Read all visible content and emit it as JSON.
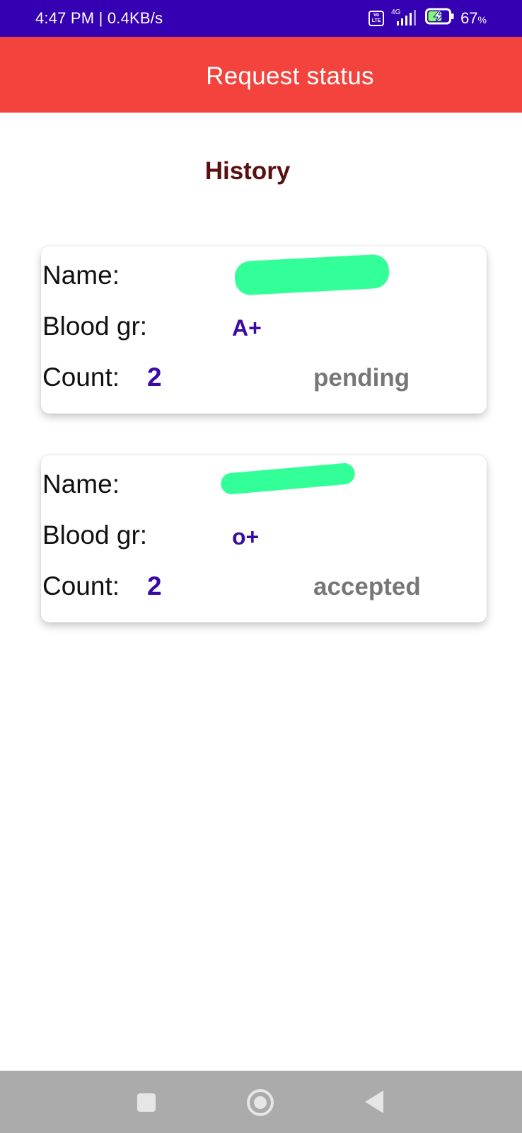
{
  "status_bar": {
    "time_speed": "4:47 PM | 0.4KB/s",
    "volte_top": "Vo",
    "volte_bottom": "LTE",
    "network": "4G",
    "battery_percent": "67",
    "battery_unit": "%",
    "battery_level": 0.67,
    "background_color": "#3500b2"
  },
  "app_bar": {
    "title": "Request status",
    "background_color": "#f4433c"
  },
  "history": {
    "heading": "History"
  },
  "requests": [
    {
      "name_label": "Name:",
      "name_value": "",
      "blood_label": "Blood gr:",
      "blood_value": "A+",
      "count_label": "Count:",
      "count_value": "2",
      "status": "pending"
    },
    {
      "name_label": "Name:",
      "name_value": "",
      "blood_label": "Blood gr:",
      "blood_value": "o+",
      "count_label": "Count:",
      "count_value": "2",
      "status": "accepted"
    }
  ],
  "nav_bar": {
    "icons": [
      "recent-apps-icon",
      "home-icon",
      "back-icon"
    ]
  },
  "colors": {
    "accent_value": "#3a0ca3",
    "status_text": "#777777",
    "heading": "#5a0f0f",
    "redaction": "#33ff99"
  }
}
